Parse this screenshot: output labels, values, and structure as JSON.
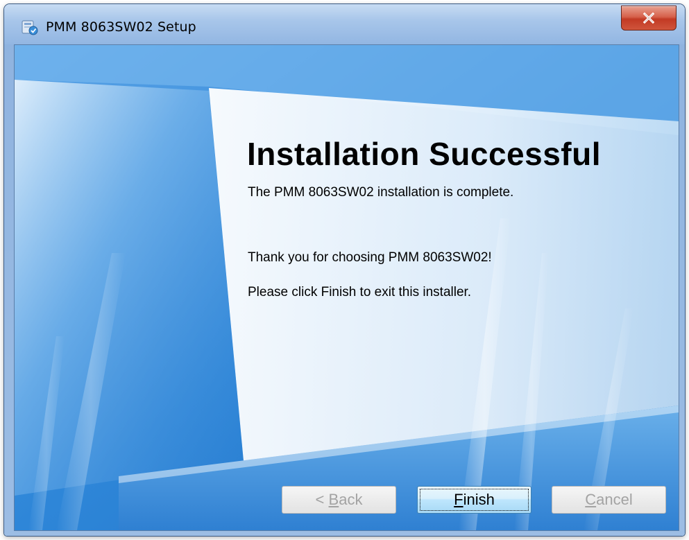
{
  "window": {
    "title": "PMM 8063SW02 Setup",
    "close_glyph": "x"
  },
  "content": {
    "heading": "Installation Successful",
    "line1": "The PMM 8063SW02 installation is  complete.",
    "line2": "Thank you for choosing PMM 8063SW02!",
    "line3": "Please click Finish to exit this installer."
  },
  "buttons": {
    "back": {
      "prefix": "< ",
      "accel": "B",
      "rest": "ack",
      "enabled": false
    },
    "finish": {
      "accel": "F",
      "rest": "inish",
      "enabled": true,
      "focused": true
    },
    "cancel": {
      "accel": "C",
      "rest": "ancel",
      "enabled": false
    }
  },
  "icons": {
    "title_icon": "installer-icon",
    "close_icon": "close-icon"
  },
  "colors": {
    "background_blue": "#2f7fd0",
    "close_red": "#c23a24",
    "finish_button": "#bee6fd"
  }
}
